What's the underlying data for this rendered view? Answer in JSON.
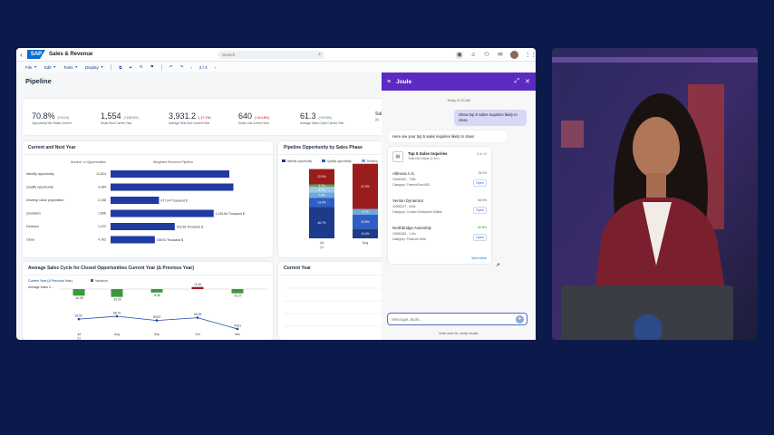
{
  "shell": {
    "back": "‹",
    "logo": "SAP",
    "title": "Sales & Revenue",
    "search_placeholder": "Search",
    "search_icon": "⌕",
    "icons": [
      "location-icon",
      "bell-icon",
      "people-icon",
      "chat-icon",
      "question-icon"
    ]
  },
  "toolbar": {
    "file": "File",
    "edit": "Edit",
    "tools": "Tools",
    "display": "Display",
    "page_indicator": "2 / 4"
  },
  "page": {
    "title": "Pipeline"
  },
  "kpis": [
    {
      "value": "70.8%",
      "delta": "(+9.1%)",
      "trend": "up",
      "label": "Opportunity Win Rates Current"
    },
    {
      "value": "1,554",
      "delta": "(+180.9%)",
      "trend": "up",
      "label": "Deals Won Current Year"
    },
    {
      "value": "3,931.2",
      "delta": "(-17.1%)",
      "trend": "down",
      "label": "Average Deal Size Current Year"
    },
    {
      "value": "640",
      "delta": "(+114.8%)",
      "trend": "down",
      "label": "Deals Lost Current Year"
    },
    {
      "value": "61.3",
      "delta": "(+19.5%)",
      "trend": "up",
      "label": "Average Sales Cycle Current Year"
    },
    {
      "value": "Sal",
      "delta": "",
      "trend": "up",
      "label": "(A)"
    }
  ],
  "cards": {
    "current_next": "Current and Next Year",
    "pipeline_phase": "Pipeline Opportunity by Sales Phase",
    "avg_cycle": "Average Sales Cycle for Closed Opportunities Current Year (Δ Previous Year)",
    "current_year": "Current Year"
  },
  "chart_data": [
    {
      "type": "bar",
      "columns": [
        "Number of Opportunities",
        "Weighted Revenue Pipeline"
      ],
      "categories": [
        "Identify opportunity",
        "Qualify opportunity",
        "Develop value proposition",
        "Quotation",
        "Decision",
        "Close"
      ],
      "counts": [
        "11,624",
        "4,384",
        "2,108",
        "1,896",
        "1,222",
        "4,762"
      ],
      "values": [
        1170,
        1210,
        477.04,
        1015.66,
        632.38,
        435.94
      ],
      "value_labels": [
        "",
        "",
        "477.04 Thousand $",
        "1,015.66 Thousand $",
        "632.38 Thousand $",
        "435.94 Thousand $"
      ],
      "color": "#1f3aa0"
    },
    {
      "type": "bar",
      "stacked": true,
      "legend": [
        "Identify opportunity",
        "Qualify opportunity",
        "Develop"
      ],
      "categories": [
        "Jul",
        "Aug"
      ],
      "sublabel": "Q3",
      "series": [
        {
          "name": "Identify opportunity",
          "color": "#1e3a8a",
          "values": [
            46.7,
            14.4
          ]
        },
        {
          "name": "Qualify opportunity",
          "color": "#2f5fc4",
          "values": [
            13.9,
            20.8
          ]
        },
        {
          "name": "Develop",
          "color": "#6fa8dc",
          "values": [
            7.6,
            8.7
          ]
        },
        {
          "name": "Quotation",
          "color": "#9fc5e8",
          "values": [
            8.5,
            0
          ]
        },
        {
          "name": "Decision",
          "color": "#58a55c",
          "values": [
            3.7,
            0
          ]
        },
        {
          "name": "Close",
          "color": "#9b1c1c",
          "values": [
            22.9,
            67.3
          ]
        }
      ],
      "value_labels": [
        [
          "46.7%",
          "13.9%",
          "7.6%",
          "8.5%",
          "3.7%",
          "22.9%"
        ],
        [
          "14.4%",
          "20.8%",
          "8.7%",
          "",
          "",
          "67.3%"
        ]
      ]
    },
    {
      "type": "bar",
      "legend_prefix": "Current Year (Δ Previous Year)",
      "legend_variance": "Variance",
      "row_label": "Average Sales C...",
      "categories": [
        "Jul",
        "Aug",
        "Sep",
        "Oct",
        "Nov"
      ],
      "sublabel": "Q3",
      "variance": [
        -16.08,
        -19.26,
        -8.36,
        5.16,
        -10.27
      ],
      "variance_labels": [
        "-16.08",
        "-19.26",
        "-8.36",
        "+5.16",
        "-10.27"
      ],
      "line_values": [
        62.52,
        68.19,
        59.83,
        65.28,
        42.81
      ],
      "line_labels": [
        "62.52",
        "68.19",
        "59.83",
        "65.28",
        "42.81"
      ]
    }
  ],
  "joule": {
    "title": "Joule",
    "timestamp": "Today 11:30 AM",
    "user_message": "Show top 5 Sales Inquiries likely to close",
    "intro": "Here are your top 5 sales inquiries likely to close:",
    "card_title": "Top 5 Sales Inquiries",
    "card_subtitle": "Total Net Value (2.1m)",
    "card_count": "3 of 12",
    "inquiries": [
      {
        "name": "Altinova A.S.",
        "id": "10000492 - 736k",
        "category": "Category: ThermoFlow 600",
        "pct": "78.2%"
      },
      {
        "name": "Veriton Dynamics",
        "id": "10000227 - 440k",
        "category": "Category: Coolton Enterprise Edition",
        "pct": "66.9%"
      },
      {
        "name": "Northbridge Assembly",
        "id": "10000183 - 1.3m",
        "category": "Category: PoolLine Ultra",
        "pct": "62.8%"
      }
    ],
    "open_label": "Open",
    "view_more": "View More",
    "input_placeholder": "Message Joule...",
    "footer": "Joule uses AI, verify results."
  }
}
